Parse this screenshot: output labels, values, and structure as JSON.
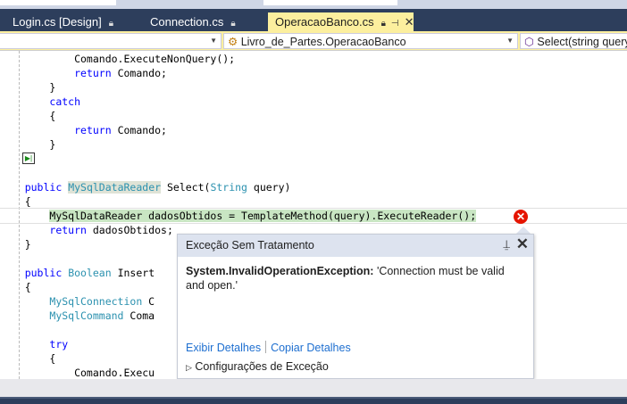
{
  "tabs": [
    {
      "label": "Login.cs [Design]",
      "active": false
    },
    {
      "label": "Connection.cs",
      "active": false
    },
    {
      "label": "OperacaoBanco.cs",
      "active": true
    }
  ],
  "nav": {
    "project": "",
    "class": "Livro_de_Partes.OperacaoBanco",
    "member": "Select(string query)"
  },
  "code_lines": [
    [
      [
        "            Comando.ExecuteNonQuery();",
        ""
      ]
    ],
    [
      [
        "            ",
        ""
      ],
      [
        "return",
        "kw"
      ],
      [
        " Comando;",
        ""
      ]
    ],
    [
      [
        "        }",
        ""
      ]
    ],
    [
      [
        "        ",
        ""
      ],
      [
        "catch",
        "kw"
      ]
    ],
    [
      [
        "        {",
        ""
      ]
    ],
    [
      [
        "            ",
        ""
      ],
      [
        "return",
        "kw"
      ],
      [
        " Comando;",
        ""
      ]
    ],
    [
      [
        "        }",
        ""
      ]
    ],
    [
      [
        "    }",
        ""
      ]
    ],
    [
      [
        "",
        ""
      ]
    ],
    [
      [
        "    ",
        ""
      ],
      [
        "public",
        "kw"
      ],
      [
        " ",
        ""
      ],
      [
        "MySqlDataReader",
        "ty hl"
      ],
      [
        " Select(",
        ""
      ],
      [
        "String",
        "ty"
      ],
      [
        " query)",
        ""
      ]
    ],
    [
      [
        "    {",
        ""
      ]
    ],
    [
      [
        "        ",
        ""
      ],
      [
        "MySqlDataReader",
        "cur"
      ],
      [
        " dadosObtidos = TemplateMethod(query).ExecuteReader();",
        "cur"
      ]
    ],
    [
      [
        "        ",
        ""
      ],
      [
        "return",
        "kw"
      ],
      [
        " dadosObtidos;",
        ""
      ]
    ],
    [
      [
        "    }",
        ""
      ]
    ],
    [
      [
        "",
        ""
      ]
    ],
    [
      [
        "    ",
        ""
      ],
      [
        "public",
        "kw"
      ],
      [
        " ",
        ""
      ],
      [
        "Boolean",
        "ty"
      ],
      [
        " Insert",
        ""
      ]
    ],
    [
      [
        "    {",
        ""
      ]
    ],
    [
      [
        "        ",
        ""
      ],
      [
        "MySqlConnection",
        "ty"
      ],
      [
        " C",
        ""
      ]
    ],
    [
      [
        "        ",
        ""
      ],
      [
        "MySqlCommand",
        "ty"
      ],
      [
        " Coma",
        ""
      ]
    ],
    [
      [
        "",
        ""
      ]
    ],
    [
      [
        "        ",
        ""
      ],
      [
        "try",
        "kw"
      ]
    ],
    [
      [
        "        {",
        ""
      ]
    ],
    [
      [
        "            Comando.Execu",
        ""
      ]
    ]
  ],
  "exception": {
    "title": "Exceção Sem Tratamento",
    "type": "System.InvalidOperationException:",
    "message": " 'Connection must be valid and open.'",
    "link_details": "Exibir Detalhes",
    "link_copy": "Copiar Detalhes",
    "settings": "Configurações de Exceção"
  },
  "colors": {
    "keyword": "#0000ff",
    "type": "#2b91af",
    "tab_active": "#fcef9e",
    "error": "#e51400"
  }
}
